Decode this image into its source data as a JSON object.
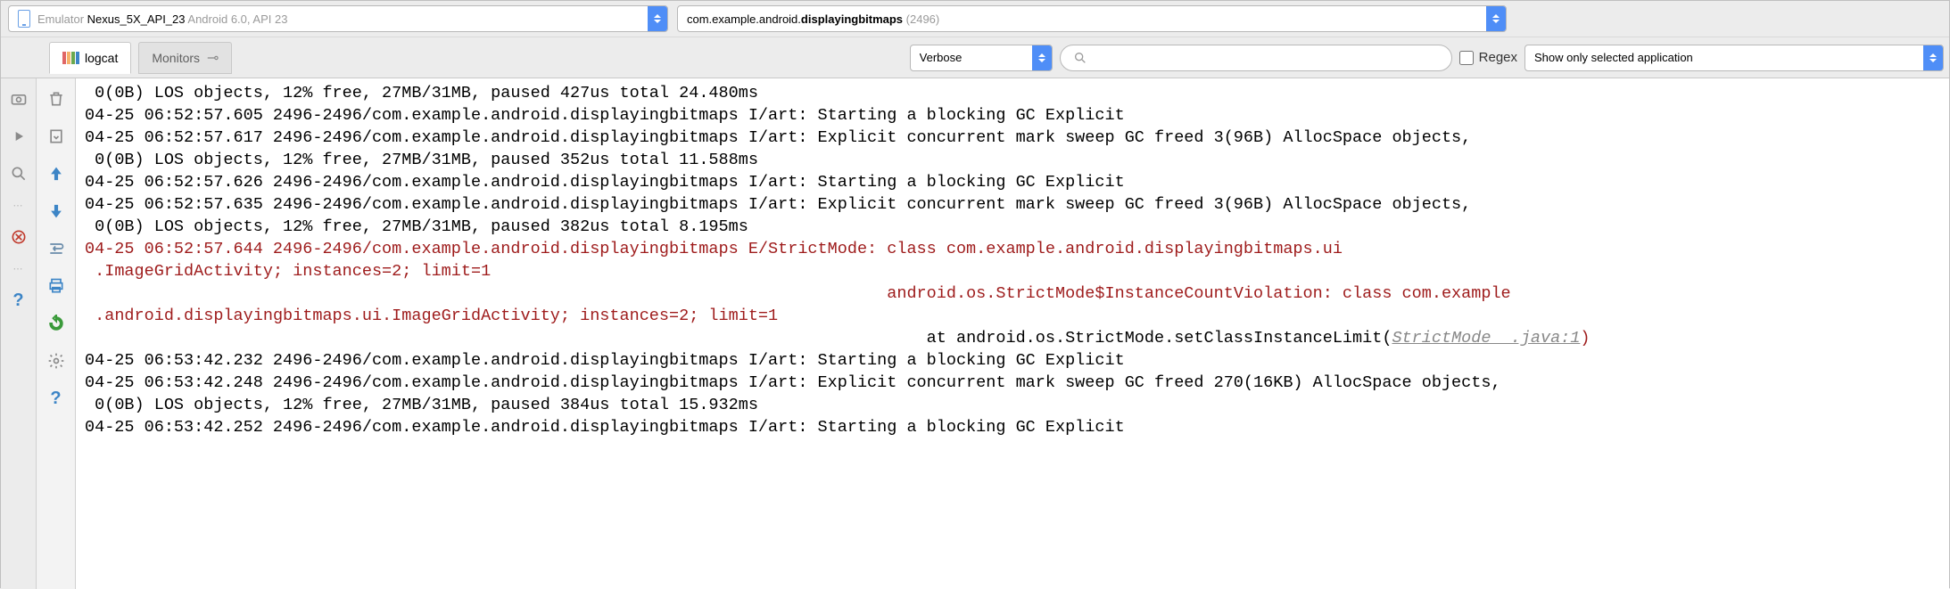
{
  "header": {
    "device_prefix": "Emulator ",
    "device_name": "Nexus_5X_API_23",
    "device_suffix": " Android 6.0, API 23",
    "process_prefix": "com.example.android.",
    "process_bold": "displayingbitmaps",
    "process_pid": " (2496)"
  },
  "tabs": {
    "logcat": "logcat",
    "monitors": "Monitors"
  },
  "controls": {
    "level": "Verbose",
    "search_placeholder": "",
    "regex_label": "Regex",
    "filter": "Show only selected application"
  },
  "log": {
    "lines": [
      {
        "cls": "",
        "text": " 0(0B) LOS objects, 12% free, 27MB/31MB, paused 427us total 24.480ms"
      },
      {
        "cls": "",
        "text": "04-25 06:52:57.605 2496-2496/com.example.android.displayingbitmaps I/art: Starting a blocking GC Explicit"
      },
      {
        "cls": "",
        "text": "04-25 06:52:57.617 2496-2496/com.example.android.displayingbitmaps I/art: Explicit concurrent mark sweep GC freed 3(96B) AllocSpace objects,"
      },
      {
        "cls": "",
        "text": " 0(0B) LOS objects, 12% free, 27MB/31MB, paused 352us total 11.588ms"
      },
      {
        "cls": "",
        "text": "04-25 06:52:57.626 2496-2496/com.example.android.displayingbitmaps I/art: Starting a blocking GC Explicit"
      },
      {
        "cls": "",
        "text": "04-25 06:52:57.635 2496-2496/com.example.android.displayingbitmaps I/art: Explicit concurrent mark sweep GC freed 3(96B) AllocSpace objects,"
      },
      {
        "cls": "",
        "text": " 0(0B) LOS objects, 12% free, 27MB/31MB, paused 382us total 8.195ms"
      },
      {
        "cls": "err",
        "text": "04-25 06:52:57.644 2496-2496/com.example.android.displayingbitmaps E/StrictMode: class com.example.android.displayingbitmaps.ui"
      },
      {
        "cls": "err",
        "text": " .ImageGridActivity; instances=2; limit=1"
      },
      {
        "cls": "err",
        "text": "                                                                                 android.os.StrictMode$InstanceCountViolation: class com.example"
      },
      {
        "cls": "err",
        "text": " .android.displayingbitmaps.ui.ImageGridActivity; instances=2; limit=1"
      },
      {
        "cls": "stack",
        "text": ""
      },
      {
        "cls": "",
        "text": "04-25 06:53:42.232 2496-2496/com.example.android.displayingbitmaps I/art: Starting a blocking GC Explicit"
      },
      {
        "cls": "",
        "text": "04-25 06:53:42.248 2496-2496/com.example.android.displayingbitmaps I/art: Explicit concurrent mark sweep GC freed 270(16KB) AllocSpace objects,"
      },
      {
        "cls": "",
        "text": " 0(0B) LOS objects, 12% free, 27MB/31MB, paused 384us total 15.932ms"
      },
      {
        "cls": "",
        "text": "04-25 06:53:42.252 2496-2496/com.example.android.displayingbitmaps I/art: Starting a blocking GC Explicit"
      }
    ],
    "stack_prefix": "                                                                                     at android.os.StrictMode.setClassInstanceLimit(",
    "stack_link": "StrictMode  .java:1",
    "stack_suffix": ")"
  }
}
